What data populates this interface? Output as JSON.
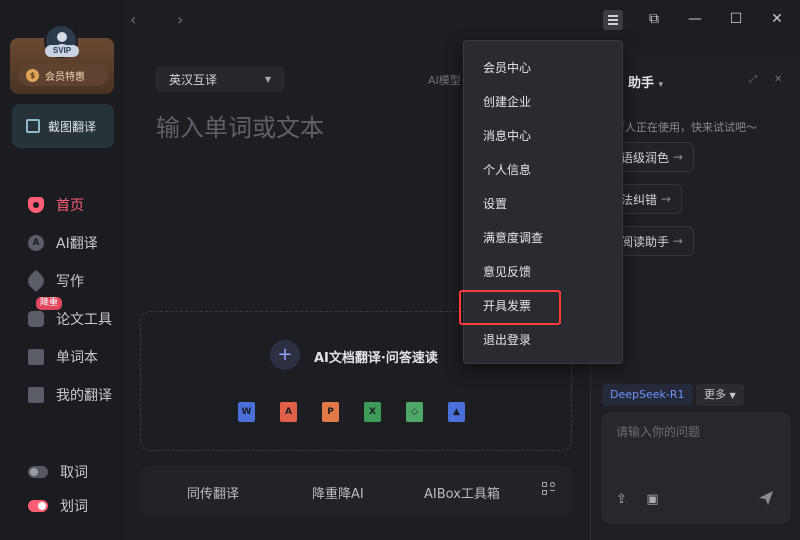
{
  "vip": {
    "badge": "SVIP",
    "promo_label": "会员特惠",
    "coin_glyph": "$"
  },
  "sidebar": {
    "screenshot_translate": "截图翻译",
    "items": [
      {
        "label": "首页"
      },
      {
        "label": "AI翻译"
      },
      {
        "label": "写作"
      },
      {
        "label": "论文工具",
        "tag": "降重"
      },
      {
        "label": "单词本"
      },
      {
        "label": "我的翻译"
      }
    ],
    "toggles": [
      {
        "label": "取词",
        "on": false
      },
      {
        "label": "划词",
        "on": true
      }
    ]
  },
  "nav": {
    "back": "‹",
    "forward": "›"
  },
  "window": {
    "restore": "⧉",
    "minimize": "—",
    "maximize": "☐",
    "close": "✕"
  },
  "main": {
    "language_select": "英汉互译",
    "model_label": "AI模型",
    "input_placeholder": "输入单词或文本",
    "doc_translate_title": "AI文档翻译·问答速读",
    "file_types": [
      {
        "glyph": "W",
        "color": "#4a6fd8"
      },
      {
        "glyph": "A",
        "color": "#e0604a"
      },
      {
        "glyph": "P",
        "color": "#e07a4a"
      },
      {
        "glyph": "X",
        "color": "#3f9a5a"
      },
      {
        "glyph": "◇",
        "color": "#4fa86a"
      },
      {
        "glyph": "▲",
        "color": "#4a6fd8"
      }
    ],
    "tools": [
      "同传翻译",
      "降重降AI",
      "AIBox工具箱"
    ]
  },
  "assistant": {
    "title": "助手",
    "subtitle": "万人正在使用，快来试试吧～",
    "chips": [
      "语级润色",
      "法纠错",
      "阅读助手"
    ],
    "model": "DeepSeek-R1",
    "more": "更多",
    "ask_placeholder": "请输入你的问题"
  },
  "dropdown_menu": {
    "items": [
      "会员中心",
      "创建企业",
      "消息中心",
      "个人信息",
      "设置",
      "满意度调查",
      "意见反馈",
      "开具发票",
      "退出登录"
    ],
    "highlighted": "开具发票"
  },
  "colors": {
    "accent": "#ff5e74",
    "highlight": "#ff3b3b",
    "model_blue": "#6c93ff"
  }
}
